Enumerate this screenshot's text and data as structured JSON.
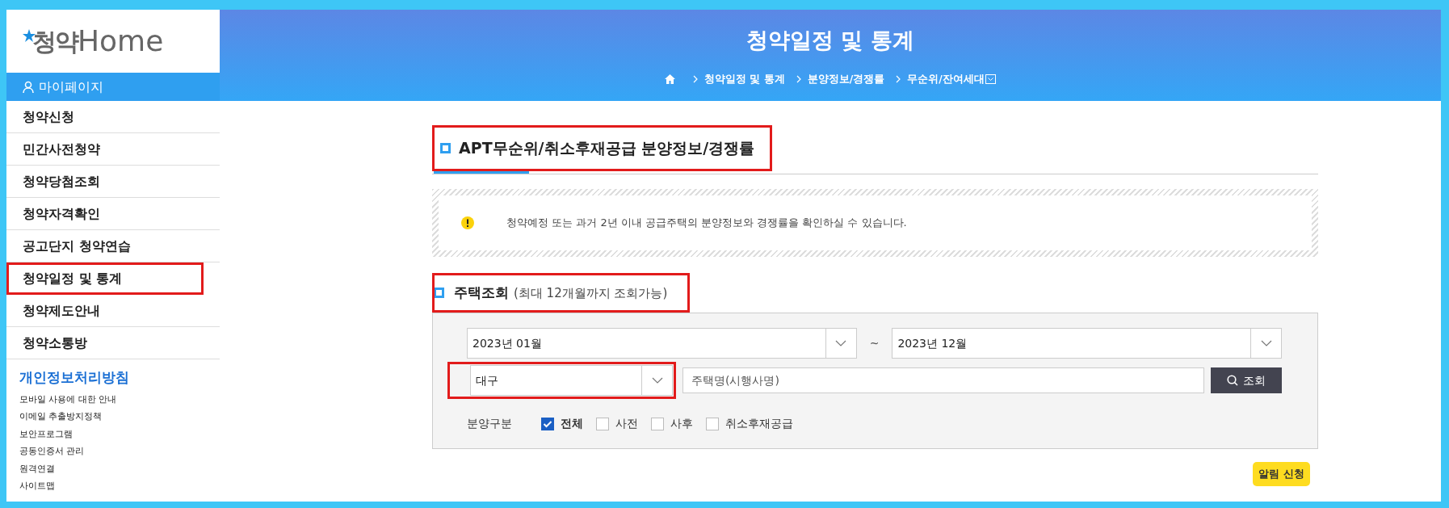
{
  "logo": {
    "text_1": "청약",
    "text_2": "Home"
  },
  "mypage": "마이페이지",
  "sidebar": {
    "items": [
      {
        "label": "청약신청",
        "highlighted": false
      },
      {
        "label": "민간사전청약",
        "highlighted": false
      },
      {
        "label": "청약당첨조회",
        "highlighted": false
      },
      {
        "label": "청약자격확인",
        "highlighted": false
      },
      {
        "label": "공고단지 청약연습",
        "highlighted": false
      },
      {
        "label": "청약일정 및 통계",
        "highlighted": true
      },
      {
        "label": "청약제도안내",
        "highlighted": false
      },
      {
        "label": "청약소통방",
        "highlighted": false
      }
    ]
  },
  "policy": {
    "title": "개인정보처리방침",
    "links": [
      "모바일 사용에 대한 안내",
      "이메일 추출방지정책",
      "보안프로그램",
      "공동인증서 관리",
      "원격연결",
      "사이트맵"
    ]
  },
  "header": {
    "title": "청약일정 및 통계",
    "breadcrumb": [
      "청약일정 및 통계",
      "분양정보/경쟁률",
      "무순위/잔여세대"
    ]
  },
  "section": {
    "title": "APT무순위/취소후재공급 분양정보/경쟁률",
    "highlighted": true
  },
  "notice": "청약예정 또는 과거 2년 이내 공급주택의 분양정보와 경쟁률을 확인하실 수 있습니다.",
  "search_section": {
    "title": "주택조회",
    "note": "(최대 12개월까지 조회가능)",
    "highlighted": true
  },
  "form": {
    "start_month": "2023년 01월",
    "separator": "~",
    "end_month": "2023년 12월",
    "region": {
      "value": "대구",
      "highlighted": true
    },
    "name_field": {
      "placeholder": "주택명(시행사명)"
    },
    "search_button": "조회",
    "type_label": "분양구분",
    "types": [
      {
        "label": "전체",
        "checked": true
      },
      {
        "label": "사전",
        "checked": false
      },
      {
        "label": "사후",
        "checked": false
      },
      {
        "label": "취소후재공급",
        "checked": false
      }
    ]
  },
  "alert_button": "알림 신청"
}
